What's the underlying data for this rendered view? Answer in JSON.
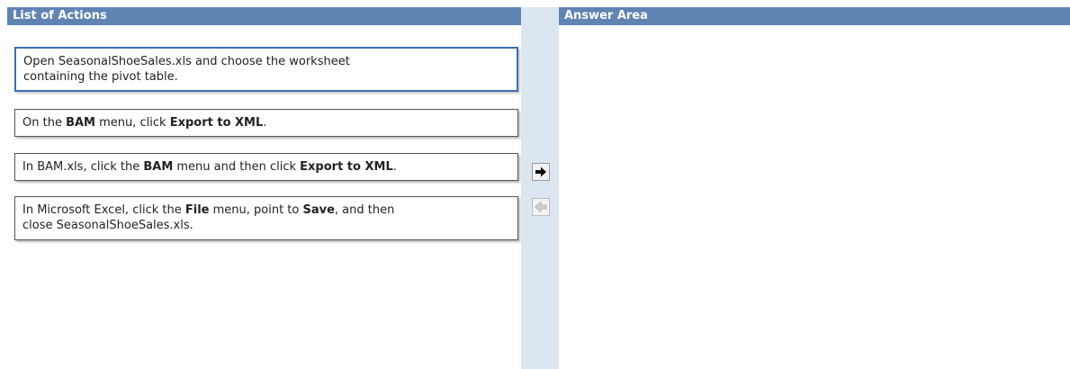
{
  "left_panel": {
    "title": "List of Actions",
    "actions": [
      {
        "segments": [
          {
            "text": "Open SeasonalShoeSales.xls and choose the worksheet",
            "bold": false
          },
          {
            "text": "\n",
            "bold": false
          },
          {
            "text": "containing the pivot table.",
            "bold": false
          }
        ],
        "selected": true
      },
      {
        "segments": [
          {
            "text": "On the ",
            "bold": false
          },
          {
            "text": "BAM",
            "bold": true
          },
          {
            "text": " menu, click ",
            "bold": false
          },
          {
            "text": "Export to XML",
            "bold": true
          },
          {
            "text": ".",
            "bold": false
          }
        ],
        "selected": false
      },
      {
        "segments": [
          {
            "text": "In BAM.xls, click the ",
            "bold": false
          },
          {
            "text": "BAM",
            "bold": true
          },
          {
            "text": " menu and then click ",
            "bold": false
          },
          {
            "text": "Export to XML",
            "bold": true
          },
          {
            "text": ".",
            "bold": false
          }
        ],
        "selected": false
      },
      {
        "segments": [
          {
            "text": "In Microsoft Excel, click the ",
            "bold": false
          },
          {
            "text": "File",
            "bold": true
          },
          {
            "text": " menu, point to ",
            "bold": false
          },
          {
            "text": "Save",
            "bold": true
          },
          {
            "text": ", and then",
            "bold": false
          },
          {
            "text": "\n",
            "bold": false
          },
          {
            "text": "close SeasonalShoeSales.xls.",
            "bold": false
          }
        ],
        "selected": false
      }
    ]
  },
  "right_panel": {
    "title": "Answer Area"
  },
  "controls": {
    "move_right": {
      "icon": "arrow-right-icon",
      "enabled": true
    },
    "move_left": {
      "icon": "arrow-left-icon",
      "enabled": false
    }
  },
  "colors": {
    "header_bg": "#5f84b4",
    "divider_bg": "#dbe6f1",
    "selected_border": "#3b6fb6"
  }
}
